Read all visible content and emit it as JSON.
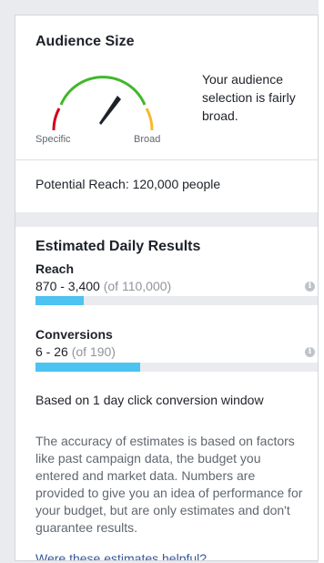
{
  "audience_size": {
    "title": "Audience Size",
    "gauge": {
      "left_label": "Specific",
      "right_label": "Broad",
      "colors": {
        "specific": "#d0021b",
        "middle": "#42b72a",
        "broad": "#f7b928",
        "needle": "#1d2129"
      }
    },
    "description": "Your audience selection is fairly broad.",
    "potential_reach": "Potential Reach: 120,000 people"
  },
  "estimated_results": {
    "title": "Estimated Daily Results",
    "reach": {
      "label": "Reach",
      "range": "870 - 3,400",
      "total": "(of 110,000)",
      "fill_fraction": 0.17
    },
    "conversions": {
      "label": "Conversions",
      "range": "6 - 26",
      "total": "(of 190)",
      "fill_fraction": 0.37
    },
    "bar_color": "#4cc3f1",
    "window_note": "Based on 1 day click conversion window",
    "disclaimer": "The accuracy of estimates is based on factors like past campaign data, the budget you entered and market data. Numbers are provided to give you an idea of performance for your budget, but are only estimates and don't guarantee results.",
    "helpful_link": "Were these estimates helpful?",
    "info_icon": "info-icon"
  }
}
